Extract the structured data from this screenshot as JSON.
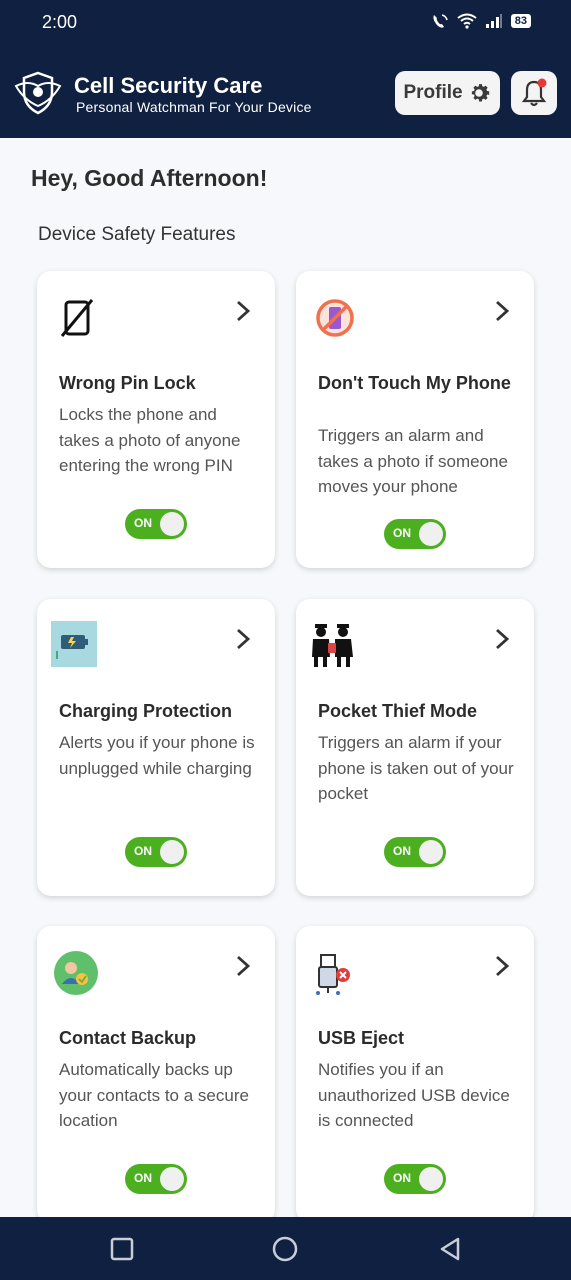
{
  "status_bar": {
    "time": "2:00",
    "battery": "83"
  },
  "header": {
    "title": "Cell Security Care",
    "subtitle": "Personal Watchman For Your Device",
    "profile_label": "Profile"
  },
  "greeting": "Hey, Good Afternoon!",
  "section_title": "Device Safety Features",
  "features": [
    {
      "icon": "phone-lock-icon",
      "title": "Wrong Pin Lock",
      "description": "Locks the phone and takes a photo of anyone entering the wrong PIN",
      "toggle": "ON"
    },
    {
      "icon": "no-touch-phone-icon",
      "title": "Don't Touch My Phone",
      "description": "Triggers an alarm and takes a photo if someone moves your phone",
      "toggle": "ON"
    },
    {
      "icon": "charging-battery-icon",
      "title": "Charging Protection",
      "description": "Alerts you if your phone is unplugged while charging",
      "toggle": "ON"
    },
    {
      "icon": "thief-icon",
      "title": "Pocket Thief Mode",
      "description": "Triggers an alarm if your phone is taken out of your pocket",
      "toggle": "ON"
    },
    {
      "icon": "contact-backup-icon",
      "title": "Contact Backup",
      "description": "Automatically backs up your contacts to a secure location",
      "toggle": "ON"
    },
    {
      "icon": "usb-eject-icon",
      "title": "USB Eject",
      "description": "Notifies you if an unauthorized USB device is connected",
      "toggle": "ON"
    }
  ],
  "colors": {
    "header_bg": "#102040",
    "toggle_on": "#4caf1f",
    "notification_dot": "#e53935"
  }
}
